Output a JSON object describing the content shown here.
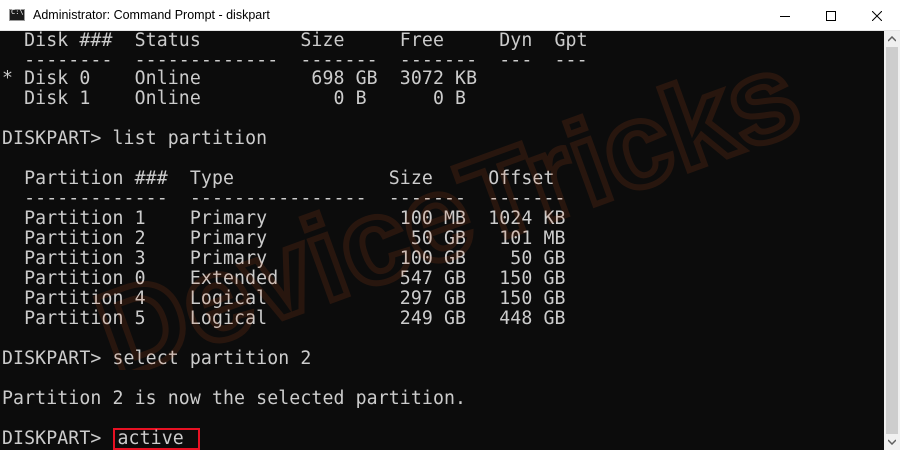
{
  "window": {
    "title": "Administrator: Command Prompt - diskpart",
    "controls": {
      "minimize_icon": "minimize-icon",
      "maximize_icon": "maximize-icon",
      "close_icon": "close-icon"
    }
  },
  "console": {
    "lines": [
      "  Disk ###  Status         Size     Free     Dyn  Gpt",
      "  --------  -------------  -------  -------  ---  ---",
      "* Disk 0    Online          698 GB  3072 KB",
      "  Disk 1    Online            0 B      0 B",
      "",
      "DISKPART> list partition",
      "",
      "  Partition ###  Type              Size     Offset",
      "  -------------  ----------------  -------  -------",
      "  Partition 1    Primary            100 MB  1024 KB",
      "  Partition 2    Primary             50 GB   101 MB",
      "  Partition 3    Primary            100 GB    50 GB",
      "  Partition 0    Extended           547 GB   150 GB",
      "  Partition 4    Logical            297 GB   150 GB",
      "  Partition 5    Logical            249 GB   448 GB",
      "",
      "DISKPART> select partition 2",
      "",
      "Partition 2 is now the selected partition.",
      ""
    ],
    "current_prompt": "DISKPART> ",
    "current_command": "active"
  },
  "watermark": {
    "text": "DeviceTricks"
  },
  "colors": {
    "console_bg": "#0c0c0c",
    "console_text": "#cccccc",
    "highlight": "#e81123",
    "watermark": "#e05a1c"
  }
}
